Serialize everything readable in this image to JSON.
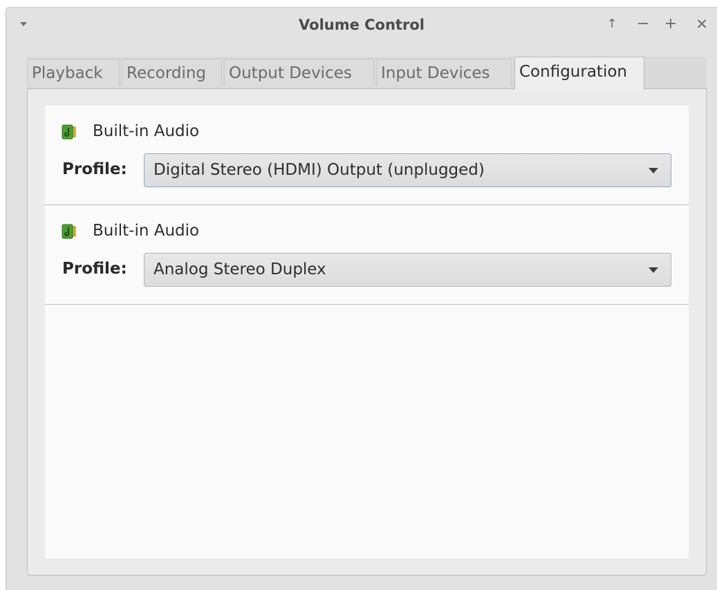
{
  "window": {
    "title": "Volume Control",
    "controls": {
      "menu_icon": "chevron-down-icon",
      "up_icon": "arrow-up-icon",
      "minimize_icon": "minimize-icon",
      "maximize_icon": "maximize-icon",
      "close_icon": "close-icon",
      "up_glyph": "↑",
      "minimize_glyph": "−",
      "maximize_glyph": "+",
      "close_glyph": "✕"
    }
  },
  "tabs": [
    {
      "label": "Playback",
      "active": false
    },
    {
      "label": "Recording",
      "active": false
    },
    {
      "label": "Output Devices",
      "active": false
    },
    {
      "label": "Input Devices",
      "active": false
    },
    {
      "label": "Configuration",
      "active": true
    }
  ],
  "devices": [
    {
      "name": "Built-in Audio",
      "icon": "audio-card-icon",
      "profile_label": "Profile:",
      "profile_value": "Digital Stereo (HDMI) Output (unplugged)"
    },
    {
      "name": "Built-in Audio",
      "icon": "audio-card-icon",
      "profile_label": "Profile:",
      "profile_value": "Analog Stereo Duplex"
    }
  ],
  "colors": {
    "window_bg": "#e2e2e2",
    "panel_bg": "#fafafa",
    "icon_green": "#4aa02c",
    "icon_yellow": "#d9b21f",
    "focus_border": "#8aa6c6"
  }
}
